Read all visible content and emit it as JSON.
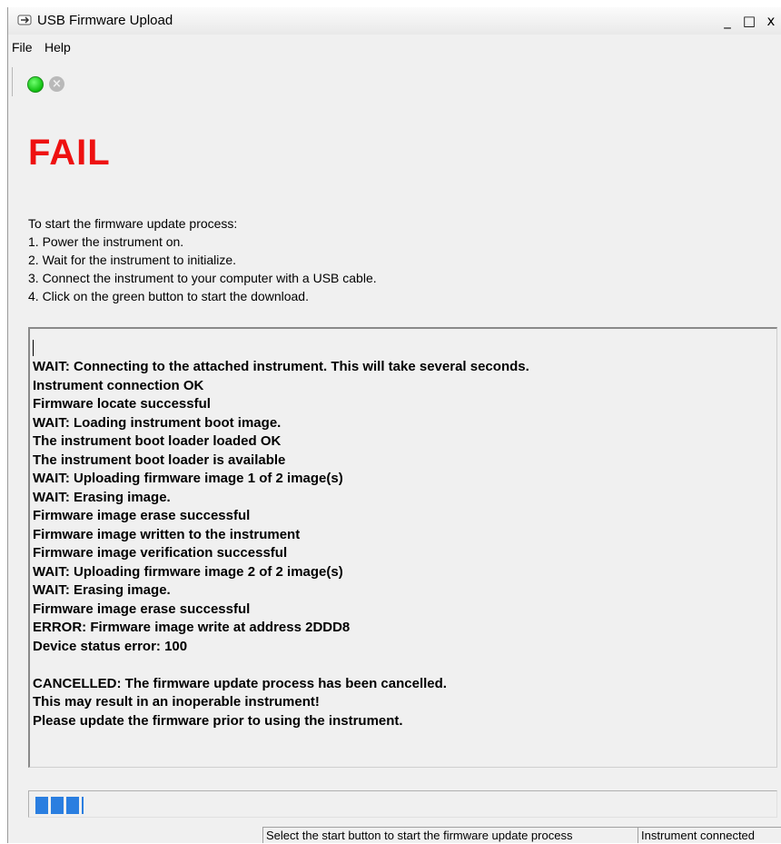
{
  "window": {
    "title": "USB Firmware Upload",
    "controls": {
      "minimize": "_",
      "maximize": "□",
      "close": "x"
    }
  },
  "menu": {
    "items": [
      "File",
      "Help"
    ]
  },
  "toolbar": {
    "start_icon": "green-circle-start",
    "stop_icon": "grey-circle-x-stop"
  },
  "status_heading": "FAIL",
  "instructions": [
    "To start the firmware update process:",
    "1. Power the instrument on.",
    "2. Wait for the instrument to initialize.",
    "3. Connect the instrument to your computer with a USB cable.",
    "4. Click on the green button to start the download."
  ],
  "log": [
    "WAIT: Connecting to the attached instrument. This will take several seconds.",
    "Instrument connection OK",
    "Firmware locate successful",
    "WAIT: Loading instrument boot image.",
    "The instrument boot loader loaded OK",
    "The instrument boot loader is available",
    "WAIT: Uploading firmware image 1 of 2 image(s)",
    "WAIT: Erasing image.",
    "Firmware image erase successful",
    "Firmware image written to the instrument",
    "Firmware image verification successful",
    "WAIT: Uploading firmware image 2 of 2 image(s)",
    "WAIT: Erasing image.",
    "Firmware image erase successful",
    "ERROR: Firmware image write at address 2DDD8",
    "Device status error: 100",
    "",
    "CANCELLED: The firmware update process has been cancelled.",
    "This may result in an inoperable instrument!",
    "Please update the firmware prior to using the instrument."
  ],
  "progress": {
    "fraction": 0.065,
    "color": "#2a7ee0"
  },
  "colors": {
    "fail": "#ee1111",
    "start_button": "#0fbf0f"
  },
  "statusbar": {
    "message": "Select the start button to start the firmware update process",
    "connection": "Instrument connected"
  }
}
